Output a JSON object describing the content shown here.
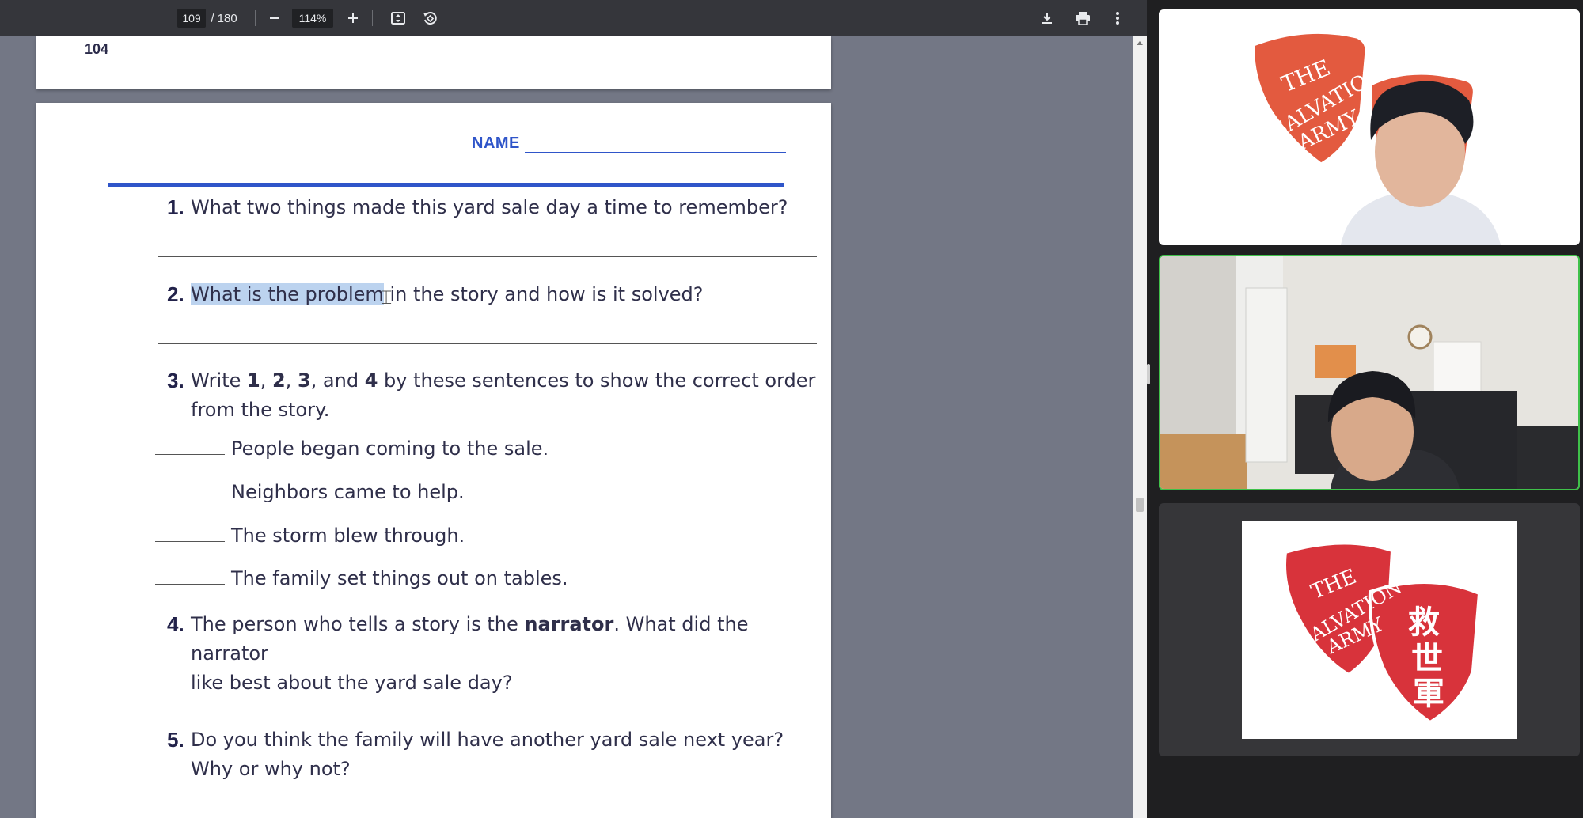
{
  "toolbar": {
    "page_current": "109",
    "page_total": "/ 180",
    "zoom": "114%",
    "icons": [
      "minus-icon",
      "plus-icon",
      "fit-page-icon",
      "rotate-icon",
      "download-icon",
      "print-icon",
      "more-vert-icon"
    ]
  },
  "prev_page": {
    "number": "104"
  },
  "worksheet": {
    "name_label": "NAME",
    "questions": [
      {
        "num": "1.",
        "text": "What two things made this yard sale day a time to remember?"
      },
      {
        "num": "2.",
        "highlighted": "What is the problem",
        "text_rest": "in the story and how is it solved?"
      },
      {
        "num": "3.",
        "line1_a": "Write ",
        "n1": "1",
        "c1": ", ",
        "n2": "2",
        "c2": ", ",
        "n3": "3",
        "c3": ", and ",
        "n4": "4",
        "line1_b": " by these sentences to show the correct order",
        "line2": "from the story."
      },
      {
        "num": "4.",
        "text_a": "The person who tells a story is the ",
        "bold": "narrator",
        "text_b": ". What did the narrator",
        "line2": "like best about the yard sale day?"
      },
      {
        "num": "5.",
        "text": "Do you think the family will have another yard sale next year?",
        "line2": "Why or why not?"
      }
    ],
    "order_items": [
      "People began coming to the sale.",
      "Neighbors came to help.",
      "The storm blew through.",
      "The family set things out on tables."
    ]
  },
  "participants": {
    "tile1": {
      "logo_text": [
        "THE",
        "SALVATION",
        "ARMY"
      ]
    },
    "tile3": {
      "logo_text": [
        "THE",
        "SALVATION",
        "ARMY"
      ],
      "chinese": [
        "救",
        "世",
        "軍"
      ]
    }
  },
  "colors": {
    "accent_blue": "#2f55c9",
    "logo_red": "#d8333b",
    "active_speaker": "#3fc14a"
  }
}
